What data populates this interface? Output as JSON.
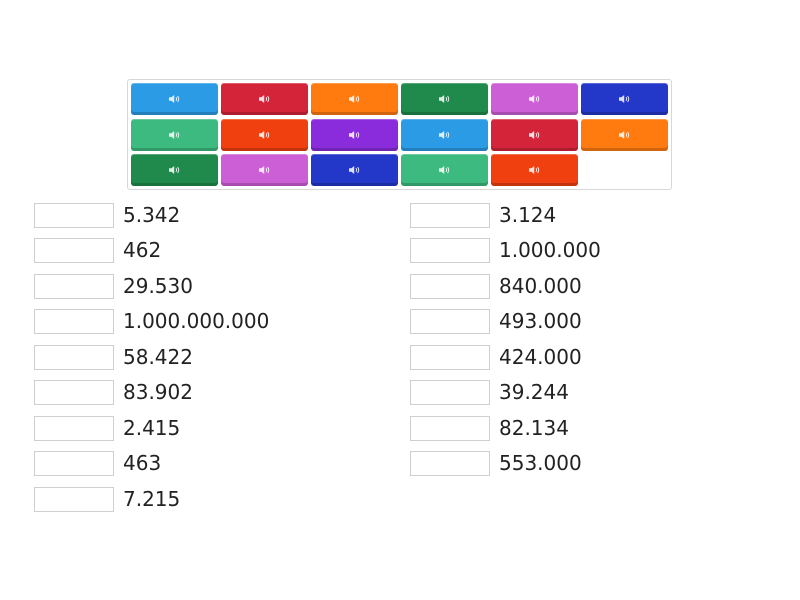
{
  "tile_bank": {
    "tiles": [
      {
        "icon": "speaker-icon",
        "color": "#2b9be6"
      },
      {
        "icon": "speaker-icon",
        "color": "#d3243a"
      },
      {
        "icon": "speaker-icon",
        "color": "#ff7a0f"
      },
      {
        "icon": "speaker-icon",
        "color": "#1f8a4c"
      },
      {
        "icon": "speaker-icon",
        "color": "#cc5fd6"
      },
      {
        "icon": "speaker-icon",
        "color": "#2337c9"
      },
      {
        "icon": "speaker-icon",
        "color": "#3dba7f"
      },
      {
        "icon": "speaker-icon",
        "color": "#f0400f"
      },
      {
        "icon": "speaker-icon",
        "color": "#8a2bdc"
      },
      {
        "icon": "speaker-icon",
        "color": "#2b9be6"
      },
      {
        "icon": "speaker-icon",
        "color": "#d3243a"
      },
      {
        "icon": "speaker-icon",
        "color": "#ff7a0f"
      },
      {
        "icon": "speaker-icon",
        "color": "#1f8a4c"
      },
      {
        "icon": "speaker-icon",
        "color": "#cc5fd6"
      },
      {
        "icon": "speaker-icon",
        "color": "#2337c9"
      },
      {
        "icon": "speaker-icon",
        "color": "#3dba7f"
      },
      {
        "icon": "speaker-icon",
        "color": "#f0400f"
      }
    ]
  },
  "answers": {
    "left": [
      "5.342",
      "462",
      "29.530",
      "1.000.000.000",
      "58.422",
      "83.902",
      "2.415",
      "463",
      "7.215"
    ],
    "right": [
      "3.124",
      "1.000.000",
      "840.000",
      "493.000",
      "424.000",
      "39.244",
      "82.134",
      "553.000"
    ]
  }
}
